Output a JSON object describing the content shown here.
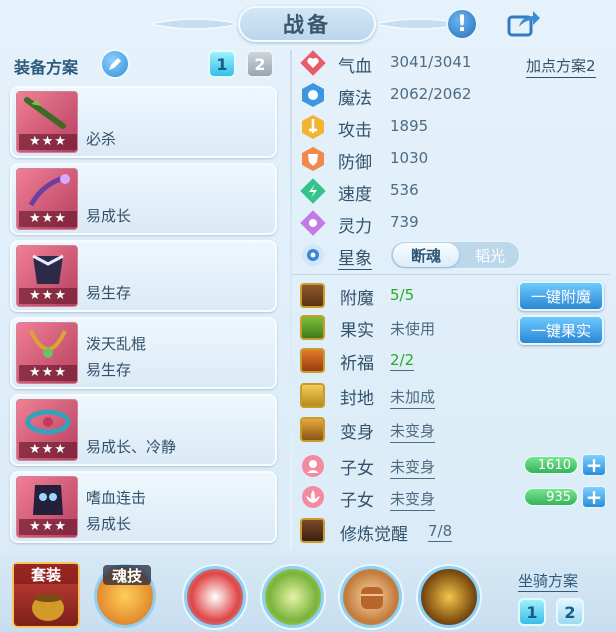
{
  "title": "战备",
  "left": {
    "header": "装备方案",
    "pages": [
      "1",
      "2"
    ],
    "equipment": [
      {
        "name": "",
        "trait": "必杀"
      },
      {
        "name": "",
        "trait": "易成长"
      },
      {
        "name": "",
        "trait": "易生存"
      },
      {
        "name": "泼天乱棍",
        "trait": "易生存"
      },
      {
        "name": "",
        "trait": "易成长、冷静"
      },
      {
        "name": "嗜血连击",
        "trait": "易成长"
      }
    ],
    "stars": "★★★"
  },
  "right": {
    "plan_link": "加点方案2",
    "stats": [
      {
        "name": "气血",
        "value": "3041/3041"
      },
      {
        "name": "魔法",
        "value": "2062/2062"
      },
      {
        "name": "攻击",
        "value": "1895"
      },
      {
        "name": "防御",
        "value": "1030"
      },
      {
        "name": "速度",
        "value": "536"
      },
      {
        "name": "灵力",
        "value": "739"
      }
    ],
    "star_label": "星象",
    "star_toggle": {
      "on": "断魂",
      "off": "韬光"
    },
    "rows": [
      {
        "name": "附魔",
        "value": "5/5"
      },
      {
        "name": "果实",
        "value": "未使用"
      },
      {
        "name": "祈福",
        "value": "2/2"
      },
      {
        "name": "封地",
        "value": "未加成"
      },
      {
        "name": "变身",
        "value": "未变身"
      },
      {
        "name": "子女",
        "value": "未变身",
        "bar": "1610"
      },
      {
        "name": "子女",
        "value": "未变身",
        "bar": "935"
      },
      {
        "name": "修炼觉醒",
        "value": "7/8"
      }
    ],
    "buttons": {
      "enchant": "一键附魔",
      "fruit": "一键果实"
    }
  },
  "bottom": {
    "set_label": "套装",
    "soul_label": "魂技",
    "mount_label": "坐骑方案",
    "mount_pages": [
      "1",
      "2"
    ]
  },
  "colors": {
    "accent": "#2a87d4",
    "green": "#2eaa1e",
    "star_bg": "#b53f61"
  }
}
